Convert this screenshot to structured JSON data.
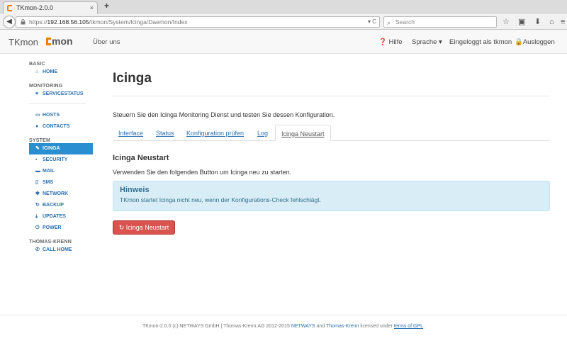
{
  "browser": {
    "tab_title": "TKmon-2.0.0",
    "tab_close": "×",
    "new_tab": "+",
    "back": "◀",
    "url_prefix": "https://",
    "url_host": "192.168.56.105",
    "url_path": "/tkmon/System/Icinga/Daemon/Index",
    "url_icons": "▾ C",
    "search_placeholder": "Search",
    "icons": [
      "star-icon",
      "reading-list-icon",
      "download-icon",
      "home-icon",
      "menu-icon"
    ]
  },
  "header": {
    "brand": "TKmon",
    "logo_text": "mon",
    "about": "Über uns",
    "help": "Hilfe",
    "language": "Sprache",
    "logged_in": "Eingeloggt als tkmon",
    "logout": "Ausloggen"
  },
  "sidebar": {
    "basic": "BASIC",
    "home": "HOME",
    "monitoring": "MONITORING",
    "servicestatus": "SERVICESTATUS",
    "hosts": "HOSTS",
    "contacts": "CONTACTS",
    "system": "SYSTEM",
    "icinga": "ICINGA",
    "security": "SECURITY",
    "mail": "MAIL",
    "sms": "SMS",
    "network": "NETWORK",
    "backup": "BACKUP",
    "updates": "UPDATES",
    "power": "POWER",
    "thomas_krenn": "THOMAS-KRENN",
    "call_home": "CALL HOME"
  },
  "main": {
    "title": "Icinga",
    "intro": "Steuern Sie den Icinga Monitoring Dienst und testen Sie dessen Konfiguration.",
    "tabs": {
      "interface": "Interface",
      "status": "Status",
      "config": "Konfiguration prüfen",
      "log": "Log",
      "restart": "Icinga Neustart"
    },
    "section_title": "Icinga Neustart",
    "section_desc": "Verwenden Sie den folgenden Button um Icinga neu zu starten.",
    "alert_title": "Hinweis",
    "alert_body": "TKmon startet Icinga nicht neu, wenn der Konfigurations-Check fehlschlägt.",
    "restart_button": "Icinga Neustart"
  },
  "footer": {
    "text1": "TKmon-2.0.0 (c) NETWAYS GmbH | Thomas-Krenn.AG 2012-2015 ",
    "netways": "NETWAYS",
    "and": " and ",
    "tk": "Thomas-Krenn",
    "licensed": " licensed under ",
    "gpl": "terms of GPL",
    "end": "."
  },
  "colors": {
    "accent": "#2a8fd0",
    "danger": "#d9534f",
    "brand_orange": "#f07d00",
    "info_bg": "#d9edf7"
  }
}
